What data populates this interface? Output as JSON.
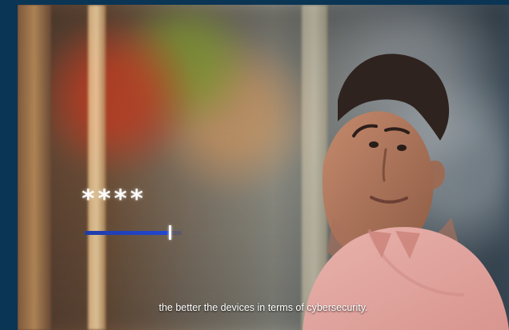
{
  "overlay": {
    "password_mask": "****",
    "progress_value": 0.88
  },
  "subtitle": {
    "text": "the better the devices in terms of cybersecurity."
  },
  "icons": {
    "cursor": "text-cursor-icon"
  },
  "colors": {
    "accent": "#2247d2",
    "frame": "#0b3554",
    "caption": "#ffffff"
  }
}
